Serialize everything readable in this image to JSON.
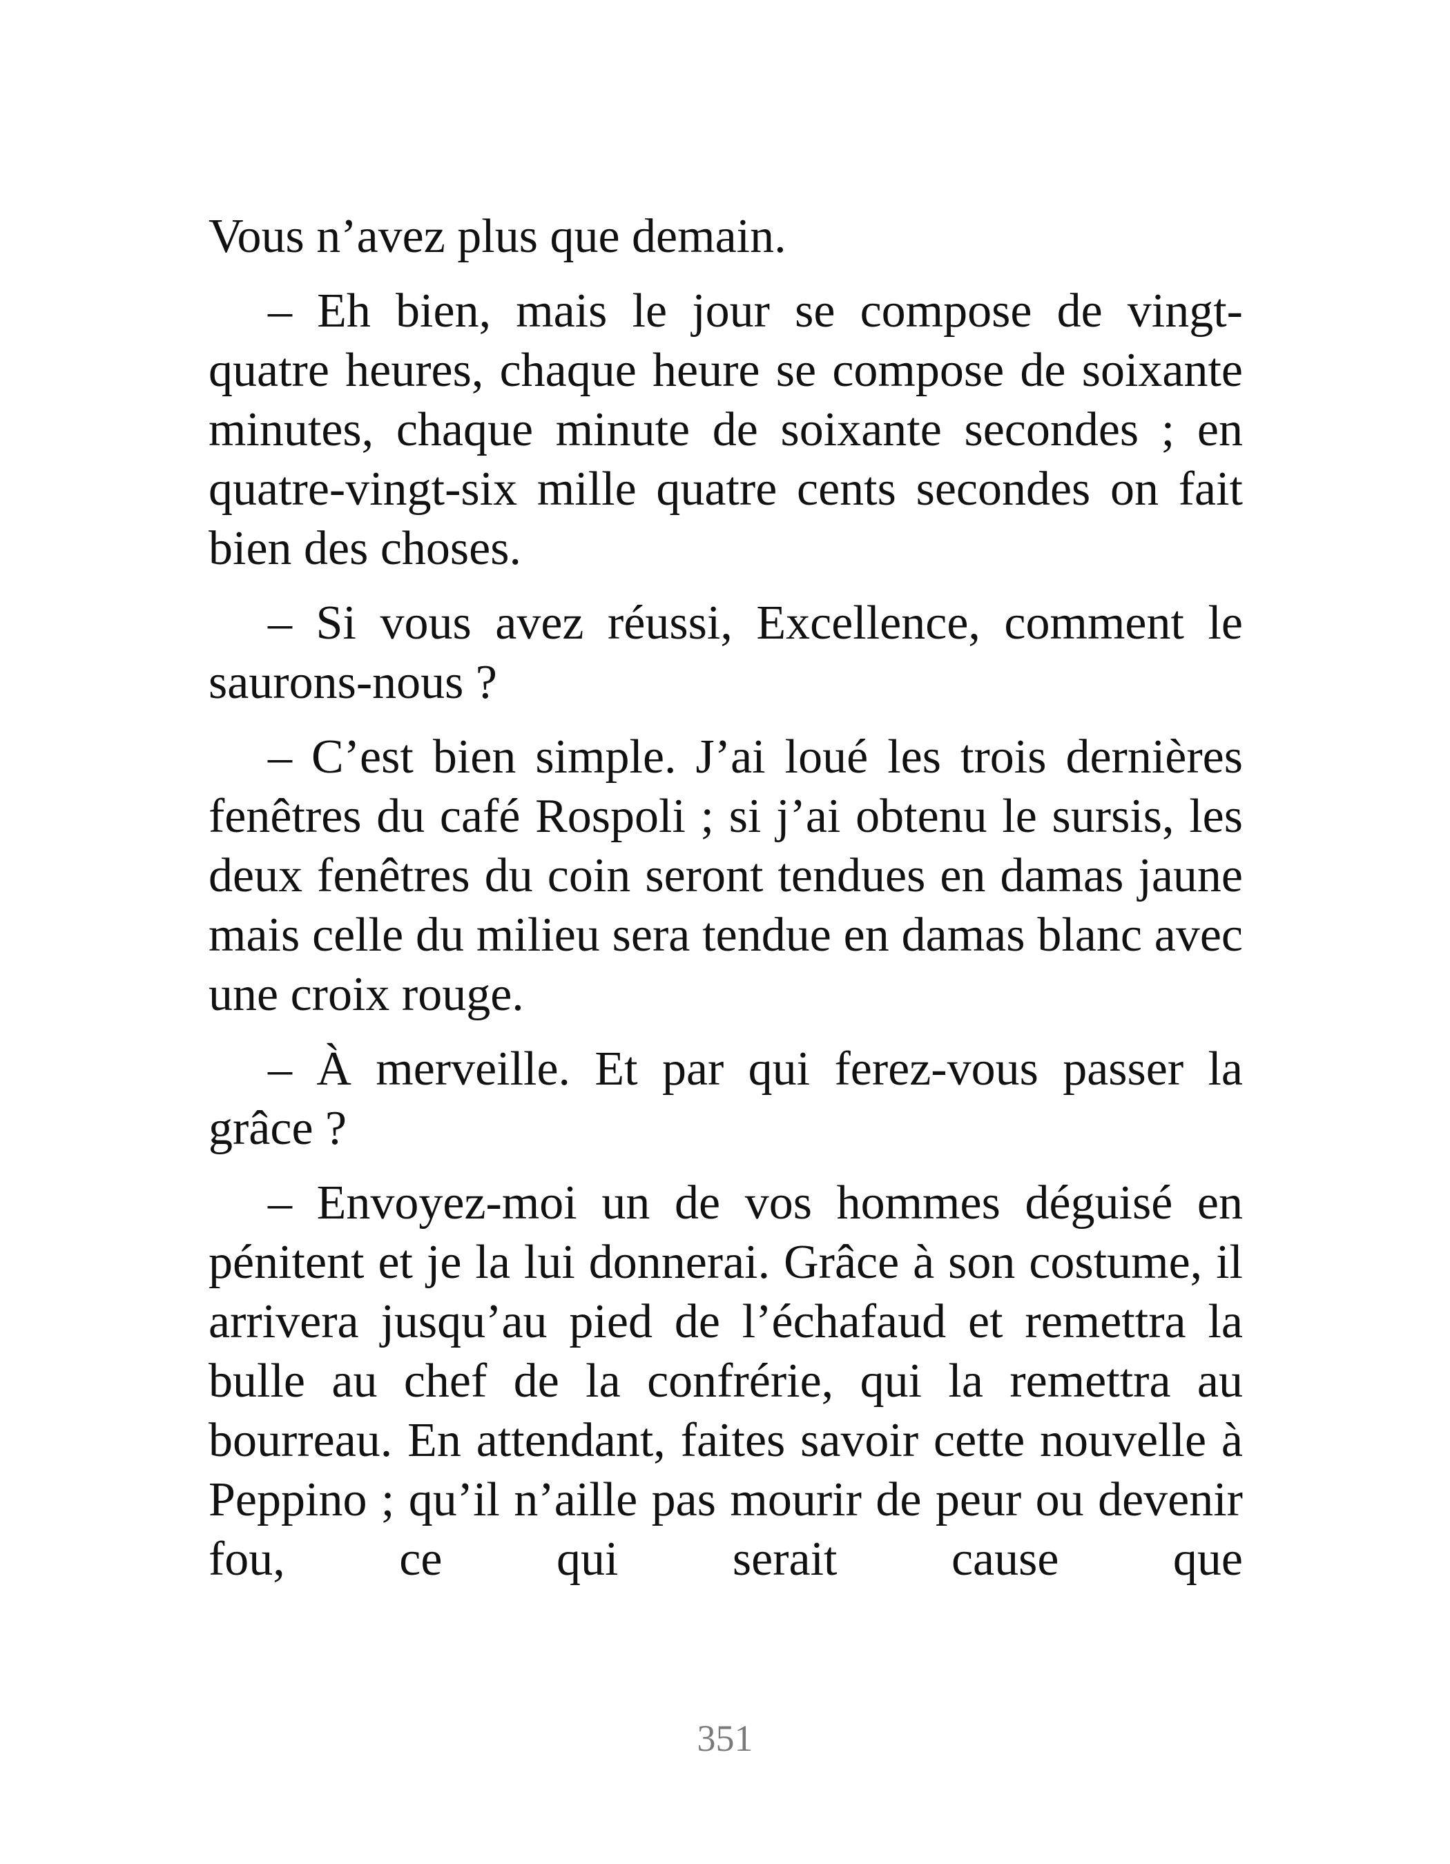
{
  "document": {
    "paragraphs": [
      "Vous n’avez plus que demain.",
      "– Eh bien, mais le jour se compose de vingt-quatre heures, chaque heure se compose de soixante minutes, chaque minute de soixante secondes ; en quatre-vingt-six mille quatre cents secondes on fait bien des choses.",
      "– Si vous avez réussi, Excellence, comment le saurons-nous ?",
      "– C’est bien simple. J’ai loué les trois dernières fenêtres du café Rospoli ; si j’ai obtenu le sursis, les deux fenêtres du coin seront tendues en damas jaune mais celle du milieu sera tendue en damas blanc avec une croix rouge.",
      "– À merveille. Et par qui ferez-vous passer la grâce ?",
      "– Envoyez-moi un de vos hommes déguisé en pénitent et je la lui donnerai. Grâce à son costume, il arrivera jusqu’au pied de l’échafaud et remettra la bulle au chef de la confrérie, qui la remettra au bourreau. En attendant, faites savoir cette nouvelle à Peppino ; qu’il n’aille pas mourir de peur ou devenir fou, ce qui serait cause que"
    ],
    "page_number": "351"
  }
}
